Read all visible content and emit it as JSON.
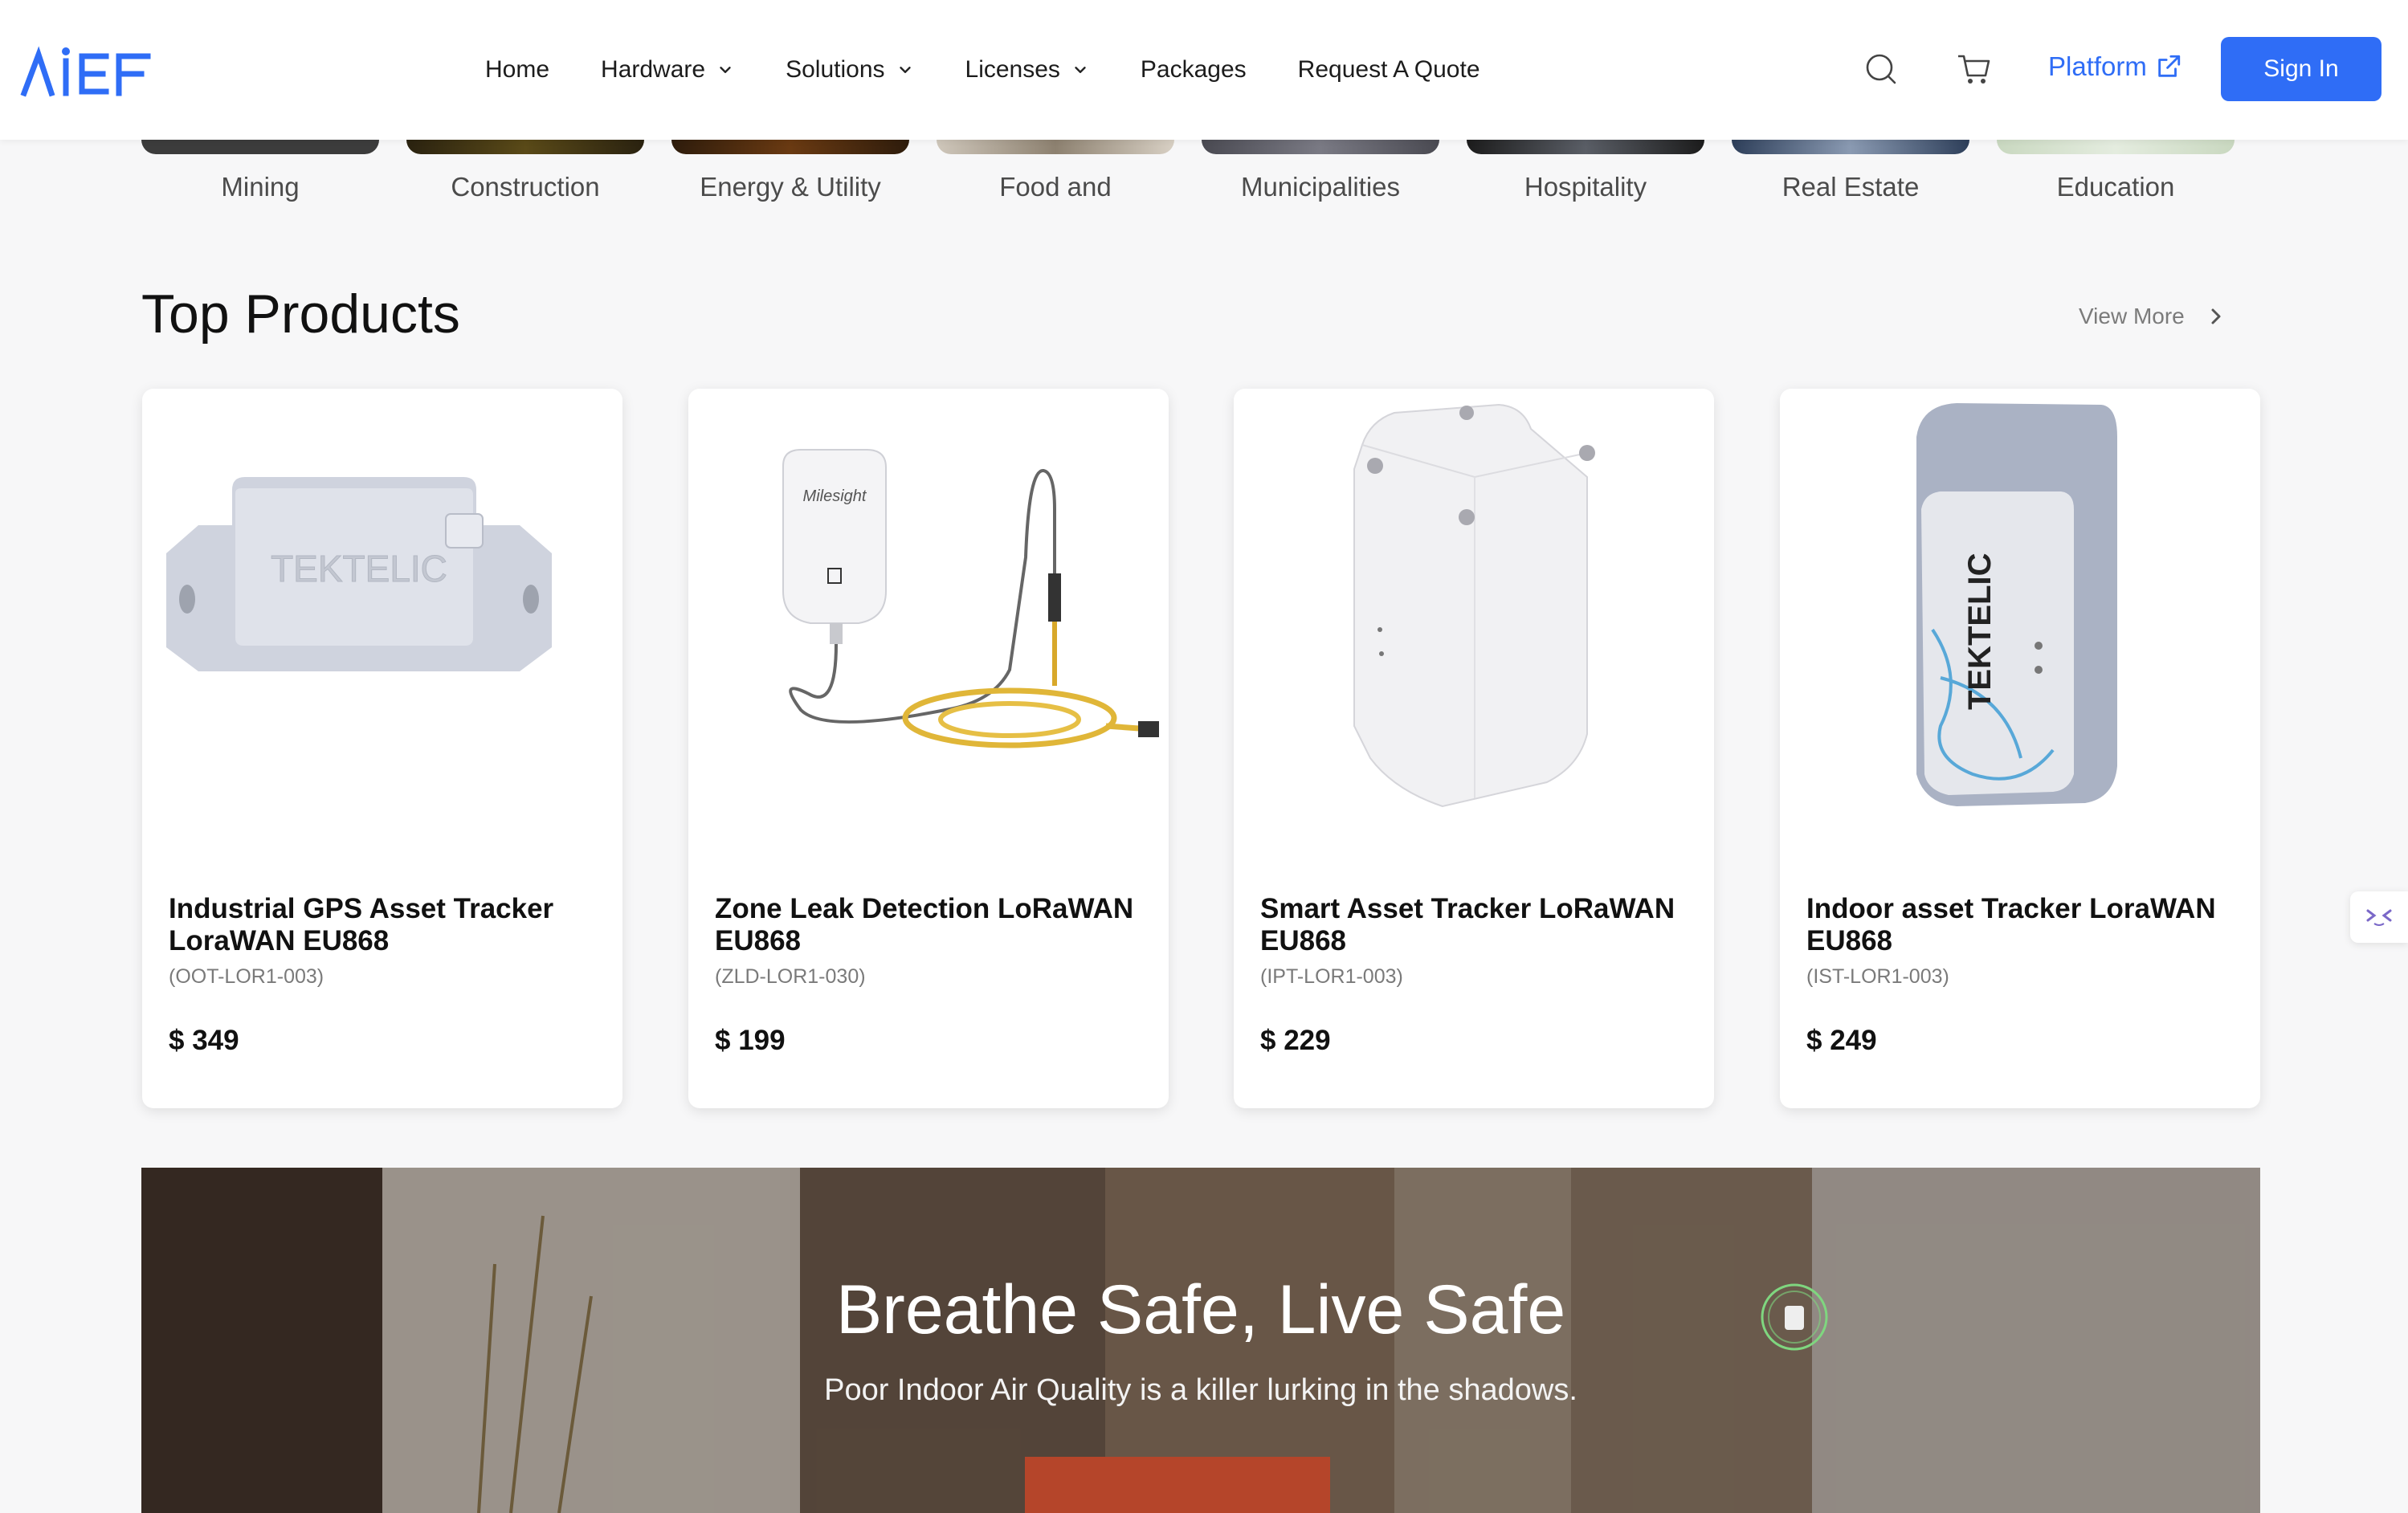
{
  "header": {
    "logo_text": "AIEF",
    "nav": [
      {
        "label": "Home",
        "has_dropdown": false
      },
      {
        "label": "Hardware",
        "has_dropdown": true
      },
      {
        "label": "Solutions",
        "has_dropdown": true
      },
      {
        "label": "Licenses",
        "has_dropdown": true
      },
      {
        "label": "Packages",
        "has_dropdown": false
      },
      {
        "label": "Request A Quote",
        "has_dropdown": false
      }
    ],
    "platform_label": "Platform",
    "sign_in_label": "Sign In",
    "accent_color": "#2f6df6"
  },
  "industries": [
    {
      "label": "Mining"
    },
    {
      "label": "Construction"
    },
    {
      "label": "Energy & Utility"
    },
    {
      "label": "Food and"
    },
    {
      "label": "Municipalities"
    },
    {
      "label": "Hospitality"
    },
    {
      "label": "Real Estate"
    },
    {
      "label": "Education"
    }
  ],
  "top_products": {
    "title": "Top Products",
    "view_more": "View More",
    "items": [
      {
        "name": "Industrial GPS Asset Tracker LoraWAN EU868",
        "sku": "(OOT-LOR1-003)",
        "price": "$ 349",
        "image_icon": "tektelic-rugged-tracker",
        "image_label": "TEKTELIC"
      },
      {
        "name": "Zone Leak Detection LoRaWAN EU868",
        "sku": "(ZLD-LOR1-030)",
        "price": "$ 199",
        "image_icon": "milesight-leak-sensor",
        "image_label": "Milesight"
      },
      {
        "name": "Smart Asset Tracker LoRaWAN EU868",
        "sku": "(IPT-LOR1-003)",
        "price": "$ 229",
        "image_icon": "white-box-tracker",
        "image_label": ""
      },
      {
        "name": "Indoor asset Tracker LoraWAN EU868",
        "sku": "(IST-LOR1-003)",
        "price": "$ 249",
        "image_icon": "tektelic-indoor-tracker",
        "image_label": "TEKTELIC"
      }
    ]
  },
  "banner": {
    "title": "Breathe Safe, Live Safe",
    "subtitle": "Poor Indoor Air Quality is a killer lurking in the shadows."
  }
}
